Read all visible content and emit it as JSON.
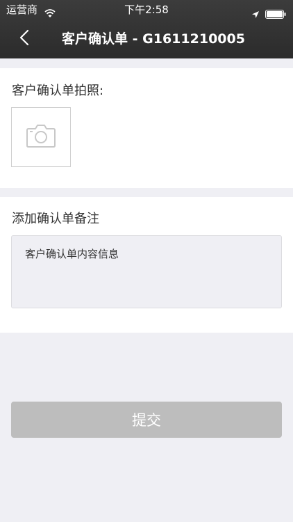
{
  "status_bar": {
    "carrier": "运营商",
    "time": "下午2:58"
  },
  "navbar": {
    "title": "客户确认单 - G1611210005",
    "back_icon": "chevron-left-icon"
  },
  "photo_section": {
    "title": "客户确认单拍照:",
    "icon": "camera-icon"
  },
  "note_section": {
    "title": "添加确认单备注",
    "placeholder": "客户确认单内容信息"
  },
  "submit_label": "提交",
  "colors": {
    "header_bg": "#2f2f2f",
    "page_bg": "#efeff4",
    "button_disabled": "#bdbdbd"
  }
}
